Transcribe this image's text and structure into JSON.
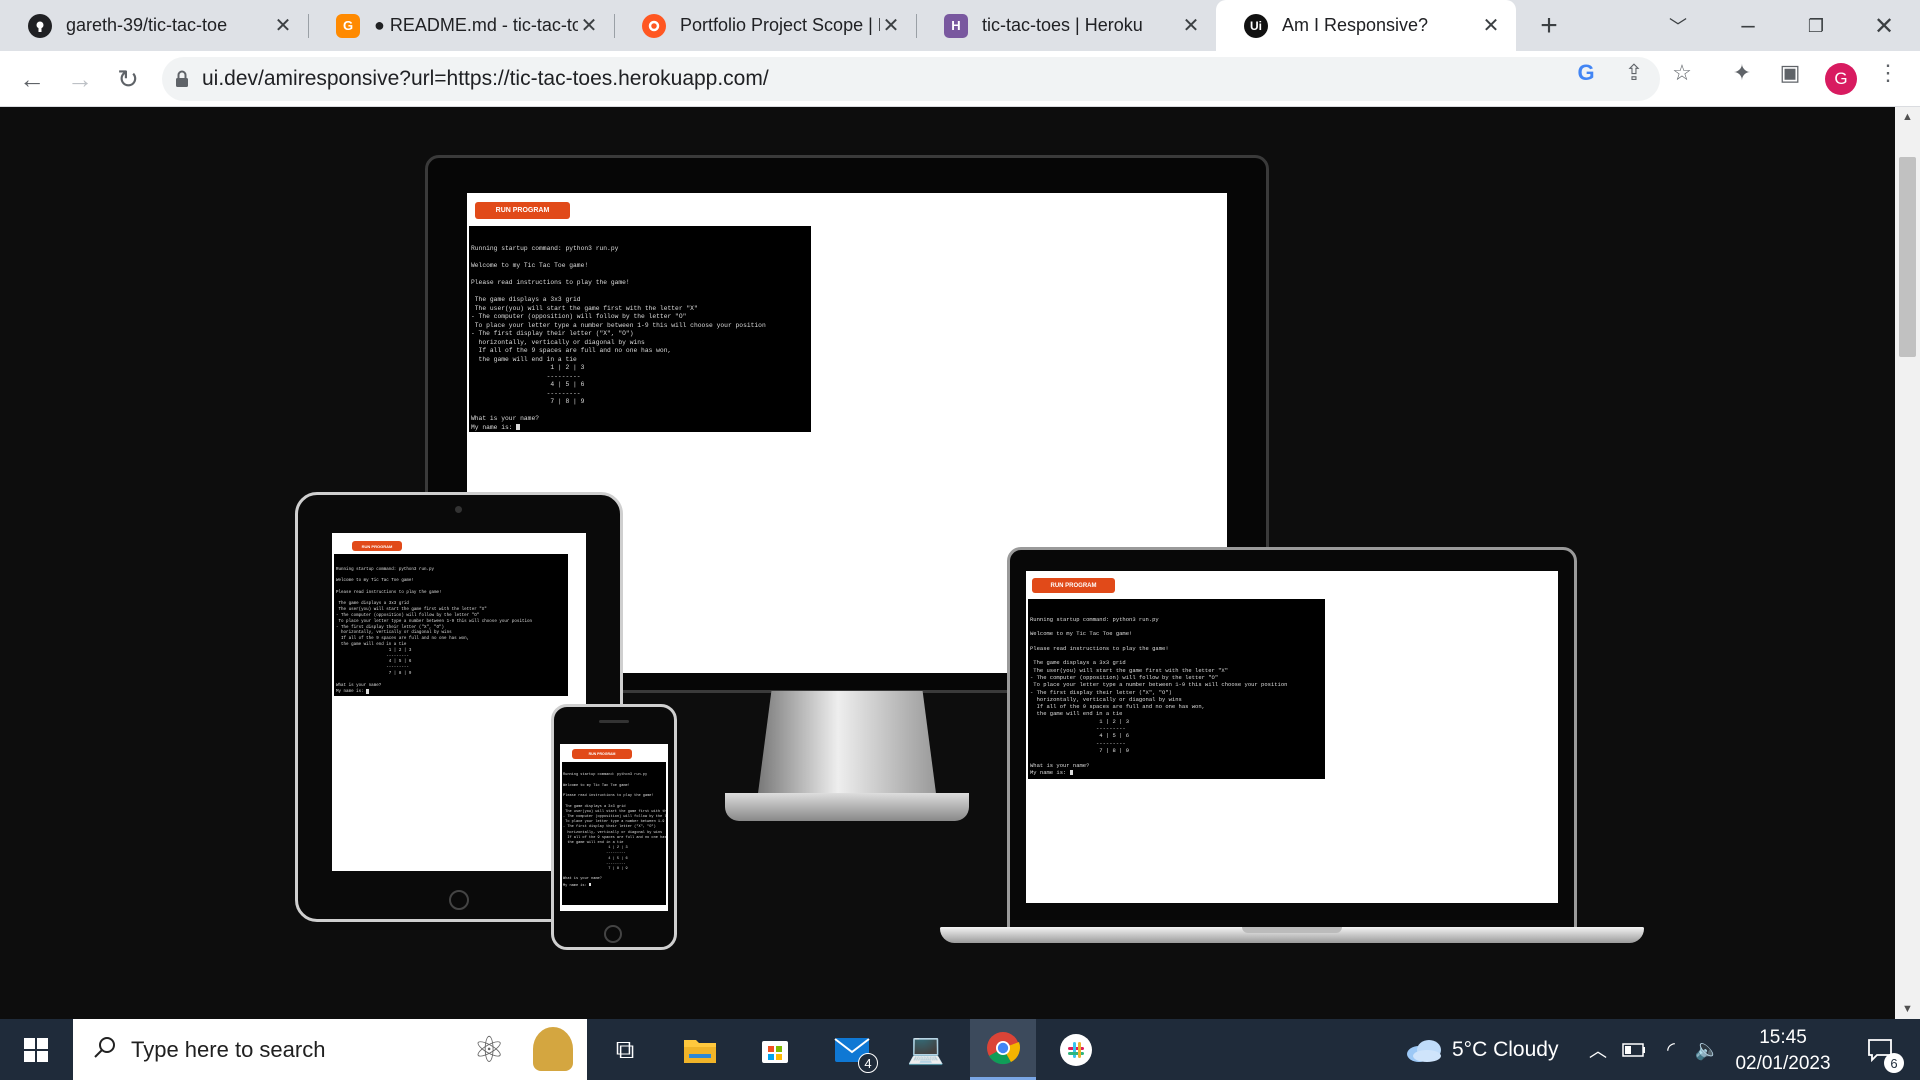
{
  "browser": {
    "tabs": [
      {
        "label": "gareth-39/tic-tac-toe",
        "favicon": "github-icon",
        "color": "#202124",
        "active": false
      },
      {
        "label": "● README.md - tic-tac-to",
        "favicon": "gitpod-icon",
        "color": "#ff8a00",
        "active": false
      },
      {
        "label": "Portfolio Project Scope | F",
        "favicon": "portfolio-icon",
        "color": "#ff5722",
        "active": false
      },
      {
        "label": "tic-tac-toes | Heroku",
        "favicon": "heroku-icon",
        "color": "#79589f",
        "active": false
      },
      {
        "label": "Am I Responsive?",
        "favicon": "amiresponsive-icon",
        "color": "#111111",
        "active": true
      }
    ],
    "new_tab_symbol": "+",
    "url": "ui.dev/amiresponsive?url=https://tic-tac-toes.herokuapp.com/",
    "profile_initial": "G"
  },
  "app": {
    "run_button_label": "RUN PROGRAM",
    "terminal_lines": [
      "Running startup command: python3 run.py",
      "",
      "Welcome to my Tic Tac Toe game!",
      "",
      "Please read instructions to play the game!",
      "",
      " The game displays a 3x3 grid",
      " The user(you) will start the game first with the letter \"X\"",
      "- The computer (opposition) will follow by the letter \"O\"",
      " To place your letter type a number between 1-9 this will choose your position",
      "- The first display their letter (\"X\", \"O\")",
      "  horizontally, vertically or diagonal by wins",
      "  If all of the 9 spaces are full and no one has won,",
      "  the game will end in a tie",
      "                     1 | 2 | 3",
      "                    ---------",
      "                     4 | 5 | 6",
      "                    ---------",
      "                     7 | 8 | 9",
      "",
      "What is your name?",
      "My name is: "
    ]
  },
  "taskbar": {
    "search_placeholder": "Type here to search",
    "mail_badge": "4",
    "weather": "5°C  Cloudy",
    "time": "15:45",
    "date": "02/01/2023",
    "notification_count": "6"
  }
}
